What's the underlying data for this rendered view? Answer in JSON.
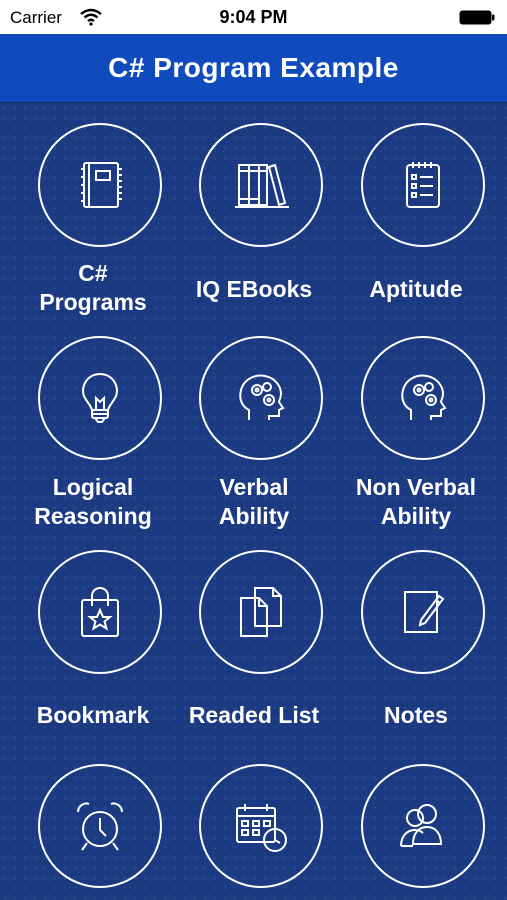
{
  "status_bar": {
    "carrier": "Carrier",
    "time": "9:04 PM"
  },
  "header": {
    "title": "C# Program Example"
  },
  "menu": [
    {
      "line1": "C#",
      "line2": "Programs",
      "icon": "notebook-icon"
    },
    {
      "line1": "IQ EBooks",
      "line2": "",
      "icon": "books-icon"
    },
    {
      "line1": "Aptitude",
      "line2": "",
      "icon": "checklist-icon"
    },
    {
      "line1": "Logical",
      "line2": "Reasoning",
      "icon": "lightbulb-icon"
    },
    {
      "line1": "Verbal",
      "line2": "Ability",
      "icon": "brain-gears-icon"
    },
    {
      "line1": "Non Verbal",
      "line2": "Ability",
      "icon": "brain-gears-icon"
    },
    {
      "line1": "Bookmark",
      "line2": "",
      "icon": "bag-star-icon"
    },
    {
      "line1": "Readed List",
      "line2": "",
      "icon": "documents-icon"
    },
    {
      "line1": "Notes",
      "line2": "",
      "icon": "note-pencil-icon"
    },
    {
      "line1": "",
      "line2": "",
      "icon": "alarm-clock-icon"
    },
    {
      "line1": "",
      "line2": "",
      "icon": "calendar-clock-icon"
    },
    {
      "line1": "",
      "line2": "",
      "icon": "users-icon"
    }
  ]
}
